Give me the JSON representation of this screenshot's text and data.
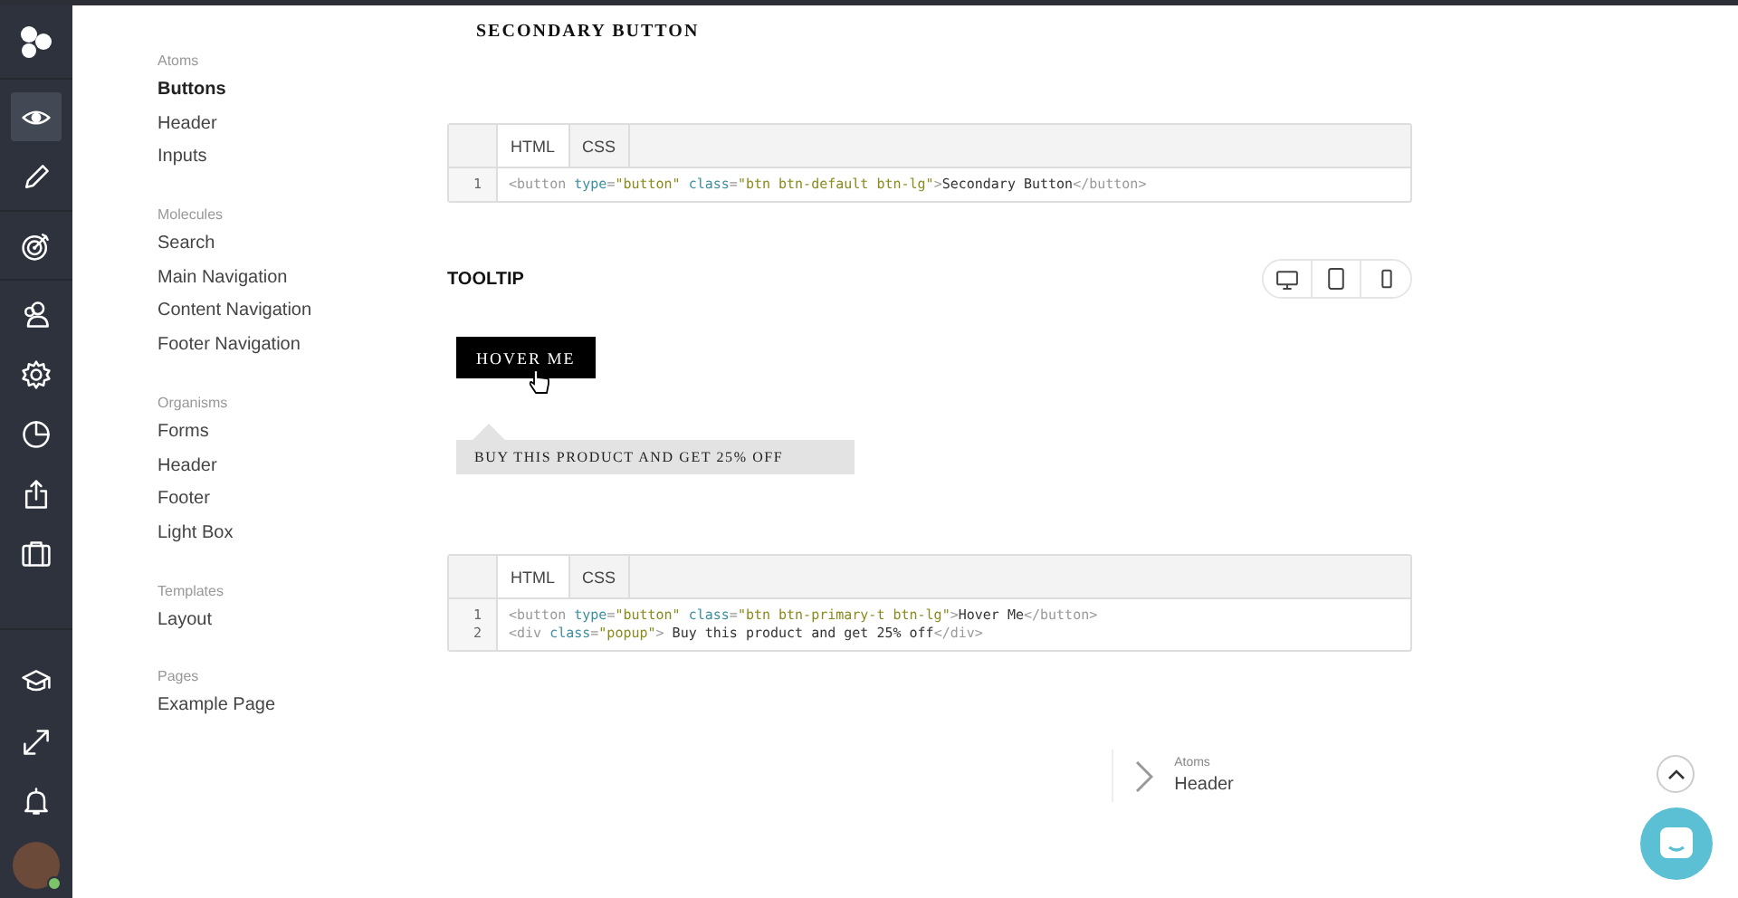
{
  "rail": {
    "items": [
      {
        "kind": "eye",
        "selected": true
      },
      {
        "kind": "pencil",
        "selected": false
      },
      {
        "kind": "target",
        "selected": false
      },
      {
        "kind": "users",
        "selected": false
      },
      {
        "kind": "gear",
        "selected": false
      },
      {
        "kind": "pie",
        "selected": false
      },
      {
        "kind": "share",
        "selected": false
      },
      {
        "kind": "briefcase",
        "selected": false
      }
    ],
    "bottom": [
      {
        "kind": "cap"
      },
      {
        "kind": "expand"
      },
      {
        "kind": "bell"
      }
    ]
  },
  "nav": [
    {
      "heading": "Atoms",
      "items": [
        {
          "label": "Buttons",
          "selected": true
        },
        {
          "label": "Header",
          "selected": false
        },
        {
          "label": "Inputs",
          "selected": false
        }
      ]
    },
    {
      "heading": "Molecules",
      "items": [
        {
          "label": "Search",
          "selected": false
        },
        {
          "label": "Main Navigation",
          "selected": false
        },
        {
          "label": "Content Navigation",
          "selected": false
        },
        {
          "label": "Footer Navigation",
          "selected": false
        }
      ]
    },
    {
      "heading": "Organisms",
      "items": [
        {
          "label": "Forms",
          "selected": false
        },
        {
          "label": "Header",
          "selected": false
        },
        {
          "label": "Footer",
          "selected": false
        },
        {
          "label": "Light Box",
          "selected": false
        }
      ]
    },
    {
      "heading": "Templates",
      "items": [
        {
          "label": "Layout",
          "selected": false
        }
      ]
    },
    {
      "heading": "Pages",
      "items": [
        {
          "label": "Example Page",
          "selected": false
        }
      ]
    }
  ],
  "secondary_title": "SECONDARY BUTTON",
  "code_blocks": [
    {
      "tabs": [
        {
          "label": "HTML",
          "selected": true
        },
        {
          "label": "CSS",
          "selected": false
        }
      ],
      "lines": [
        {
          "number": "1",
          "segments": [
            {
              "kind": "tag",
              "text": "<button "
            },
            {
              "kind": "attr",
              "text": "type"
            },
            {
              "kind": "tag",
              "text": "="
            },
            {
              "kind": "str",
              "text": "\"button\""
            },
            {
              "kind": "attr",
              "text": " class"
            },
            {
              "kind": "tag",
              "text": "="
            },
            {
              "kind": "str",
              "text": "\"btn btn-default btn-lg\""
            },
            {
              "kind": "tag",
              "text": ">"
            },
            {
              "kind": "text",
              "text": "Secondary Button"
            },
            {
              "kind": "tag",
              "text": "</button>"
            }
          ]
        }
      ]
    },
    {
      "tabs": [
        {
          "label": "HTML",
          "selected": true
        },
        {
          "label": "CSS",
          "selected": false
        }
      ],
      "lines": [
        {
          "number": "1",
          "segments": [
            {
              "kind": "tag",
              "text": "<button "
            },
            {
              "kind": "attr",
              "text": "type"
            },
            {
              "kind": "tag",
              "text": "="
            },
            {
              "kind": "str",
              "text": "\"button\""
            },
            {
              "kind": "attr",
              "text": " class"
            },
            {
              "kind": "tag",
              "text": "="
            },
            {
              "kind": "str",
              "text": "\"btn btn-primary-t btn-lg\""
            },
            {
              "kind": "tag",
              "text": ">"
            },
            {
              "kind": "text",
              "text": "Hover Me"
            },
            {
              "kind": "tag",
              "text": "</button>"
            }
          ]
        },
        {
          "number": "2",
          "segments": [
            {
              "kind": "tag",
              "text": "<div "
            },
            {
              "kind": "attr",
              "text": "class"
            },
            {
              "kind": "tag",
              "text": "="
            },
            {
              "kind": "str",
              "text": "\"popup\""
            },
            {
              "kind": "tag",
              "text": ">"
            },
            {
              "kind": "text",
              "text": " Buy this product and get 25% off"
            },
            {
              "kind": "tag",
              "text": "</div>"
            }
          ]
        }
      ]
    }
  ],
  "tooltip_section": {
    "title": "TOOLTIP",
    "devices": [
      {
        "kind": "desktop"
      },
      {
        "kind": "tablet"
      },
      {
        "kind": "phone"
      }
    ],
    "button": "HOVER ME",
    "popup": "BUY THIS PRODUCT AND GET 25% OFF"
  },
  "next_link": {
    "category": "Atoms",
    "label": "Header"
  }
}
